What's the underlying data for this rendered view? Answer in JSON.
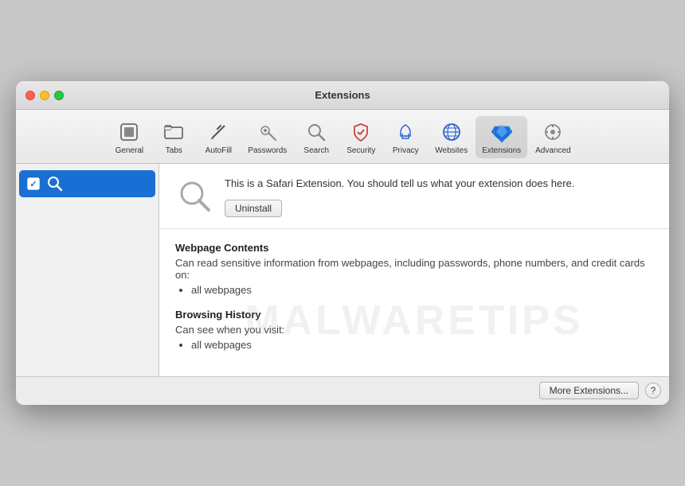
{
  "window": {
    "title": "Extensions"
  },
  "toolbar": {
    "items": [
      {
        "id": "general",
        "label": "General",
        "icon": "general-icon"
      },
      {
        "id": "tabs",
        "label": "Tabs",
        "icon": "tabs-icon"
      },
      {
        "id": "autofill",
        "label": "AutoFill",
        "icon": "autofill-icon"
      },
      {
        "id": "passwords",
        "label": "Passwords",
        "icon": "passwords-icon"
      },
      {
        "id": "search",
        "label": "Search",
        "icon": "search-toolbar-icon"
      },
      {
        "id": "security",
        "label": "Security",
        "icon": "security-icon"
      },
      {
        "id": "privacy",
        "label": "Privacy",
        "icon": "privacy-icon"
      },
      {
        "id": "websites",
        "label": "Websites",
        "icon": "websites-icon"
      },
      {
        "id": "extensions",
        "label": "Extensions",
        "icon": "extensions-icon"
      },
      {
        "id": "advanced",
        "label": "Advanced",
        "icon": "advanced-icon"
      }
    ],
    "active": "extensions"
  },
  "sidebar": {
    "items": [
      {
        "id": "search-ext",
        "label": "",
        "checked": true,
        "active": true
      }
    ]
  },
  "extension": {
    "description": "This is a Safari Extension. You should tell us what your extension does here.",
    "uninstall_label": "Uninstall",
    "permissions": [
      {
        "title": "Webpage Contents",
        "description": "Can read sensitive information from webpages, including passwords, phone numbers, and credit cards on:",
        "items": [
          "all webpages"
        ]
      },
      {
        "title": "Browsing History",
        "description": "Can see when you visit:",
        "items": [
          "all webpages"
        ]
      }
    ]
  },
  "footer": {
    "more_extensions_label": "More Extensions...",
    "help_label": "?"
  },
  "watermark": {
    "text": "MALWARETIPS"
  }
}
